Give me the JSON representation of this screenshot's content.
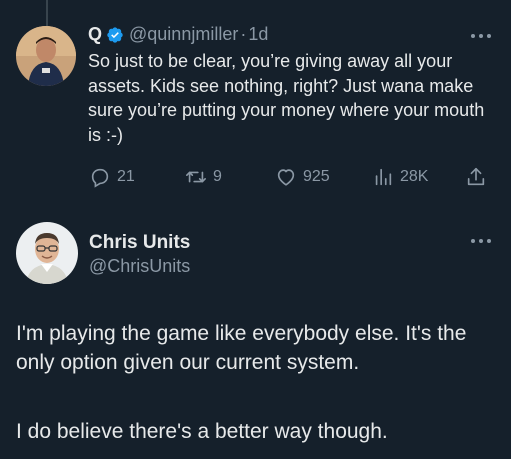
{
  "reply": {
    "display_name": "Q",
    "handle": "@quinnjmiller",
    "separator": "·",
    "time": "1d",
    "text": "So just to be clear, you’re giving away all your assets. Kids see nothing, right? Just wana make sure you’re putting your money where your mouth is :-)",
    "actions": {
      "replies": "21",
      "reposts": "9",
      "likes": "925",
      "views": "28K"
    },
    "verified": true
  },
  "main_post": {
    "display_name": "Chris Units",
    "handle": "@ChrisUnits",
    "paragraphs": [
      "I'm playing the game like everybody else. It's the only option given our current system.",
      "I do believe there's a better way though."
    ]
  },
  "icons": {
    "verified": "verified-badge-icon",
    "more": "more-horizontal-icon",
    "reply": "reply-icon",
    "repost": "repost-icon",
    "like": "heart-icon",
    "views": "views-chart-icon",
    "share": "share-icon"
  },
  "colors": {
    "background": "#15202b",
    "text_primary": "#e7e9ea",
    "text_secondary": "#8b98a5",
    "verified_blue": "#1d9bf0",
    "thread_line": "#38444d"
  }
}
